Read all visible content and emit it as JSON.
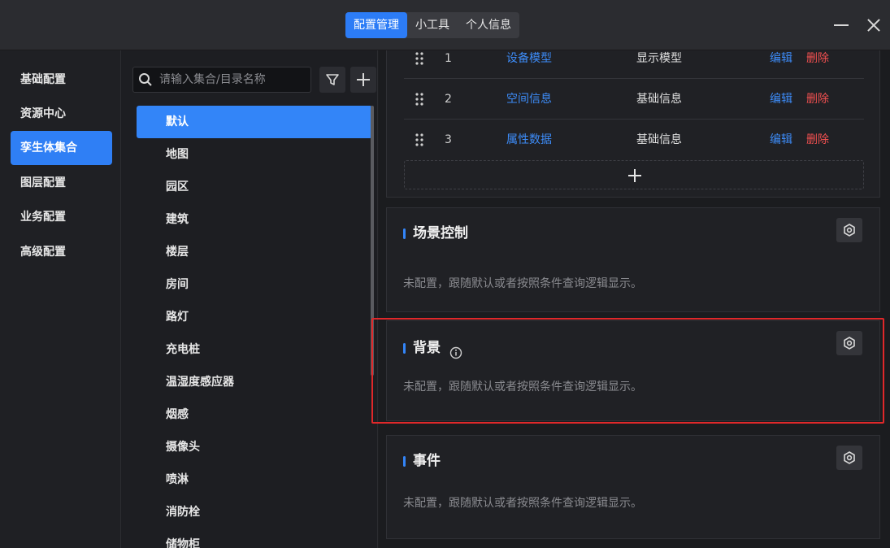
{
  "top_tabs": [
    {
      "label": "配置管理",
      "active": true
    },
    {
      "label": "小工具",
      "active": false
    },
    {
      "label": "个人信息",
      "active": false
    }
  ],
  "left_nav": {
    "items": [
      {
        "label": "基础配置",
        "active": false
      },
      {
        "label": "资源中心",
        "active": false
      },
      {
        "label": "孪生体集合",
        "active": true
      },
      {
        "label": "图层配置",
        "active": false
      },
      {
        "label": "业务配置",
        "active": false
      },
      {
        "label": "高级配置",
        "active": false
      }
    ]
  },
  "middle": {
    "search_placeholder": "请输入集合/目录名称",
    "items": [
      "默认",
      "地图",
      "园区",
      "建筑",
      "楼层",
      "房间",
      "路灯",
      "充电桩",
      "温湿度感应器",
      "烟感",
      "摄像头",
      "喷淋",
      "消防栓",
      "储物柜"
    ],
    "active_index": 0
  },
  "table": {
    "rows": [
      {
        "index": "1",
        "name": "设备模型",
        "type": "显示模型",
        "edit": "编辑",
        "delete": "删除"
      },
      {
        "index": "2",
        "name": "空间信息",
        "type": "基础信息",
        "edit": "编辑",
        "delete": "删除"
      },
      {
        "index": "3",
        "name": "属性数据",
        "type": "基础信息",
        "edit": "编辑",
        "delete": "删除"
      }
    ]
  },
  "sections": [
    {
      "title": "场景控制",
      "desc": "未配置，跟随默认或者按照条件查询逻辑显示。"
    },
    {
      "title": "背景",
      "desc": "未配置，跟随默认或者按照条件查询逻辑显示。"
    },
    {
      "title": "事件",
      "desc": "未配置，跟随默认或者按照条件查询逻辑显示。"
    }
  ],
  "colors": {
    "accent": "#2c7cf6",
    "link": "#3d8cf8",
    "danger": "#f05050",
    "highlight": "#e0282a"
  }
}
